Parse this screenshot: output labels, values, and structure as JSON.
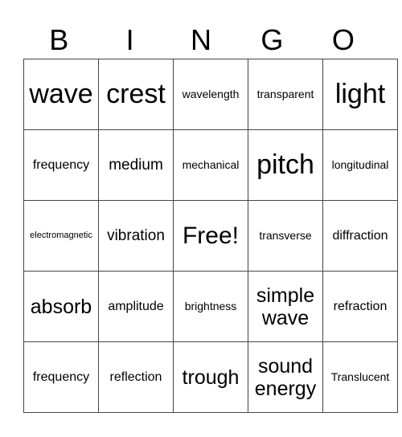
{
  "header": [
    "B",
    "I",
    "N",
    "G",
    "O"
  ],
  "rows": [
    [
      "wave",
      "crest",
      "wavelength",
      "transparent",
      "light"
    ],
    [
      "frequency",
      "medium",
      "mechanical",
      "pitch",
      "longitudinal"
    ],
    [
      "electromagnetic",
      "vibration",
      "Free!",
      "transverse",
      "diffraction"
    ],
    [
      "absorb",
      "amplitude",
      "brightness",
      "simple wave",
      "refraction"
    ],
    [
      "frequency",
      "reflection",
      "trough",
      "sound energy",
      "Translucent"
    ]
  ]
}
